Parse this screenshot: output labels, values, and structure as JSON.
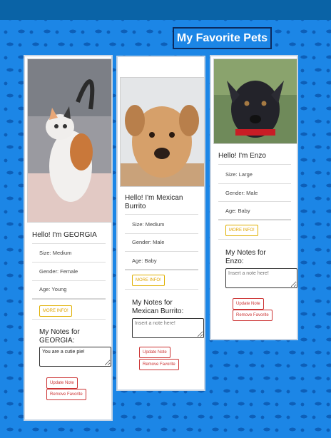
{
  "header": {
    "title": "My Favorite Pets"
  },
  "labels": {
    "more_info": "MORE INFO!",
    "update_note": "Update Note",
    "remove_favorite": "Remove Favorite",
    "note_placeholder": "Insert a note here!"
  },
  "pets": [
    {
      "greeting": "Hello! I'm GEORGIA",
      "size": "Size: Medium",
      "gender": "Gender: Female",
      "age": "Age: Young",
      "notes_heading": "My Notes for GEORGIA:",
      "note_value": "You are a cutie pie!",
      "photo_icon": "calico-cat-photo"
    },
    {
      "greeting": "Hello! I'm Mexican Burrito",
      "size": "Size: Medium",
      "gender": "Gender: Male",
      "age": "Age: Baby",
      "notes_heading": "My Notes for Mexican Burrito:",
      "note_value": "",
      "photo_icon": "tan-puppy-photo"
    },
    {
      "greeting": "Hello! I'm Enzo",
      "size": "Size: Large",
      "gender": "Gender: Male",
      "age": "Age: Baby",
      "notes_heading": "My Notes for Enzo:",
      "note_value": "",
      "photo_icon": "black-puppy-photo"
    }
  ]
}
